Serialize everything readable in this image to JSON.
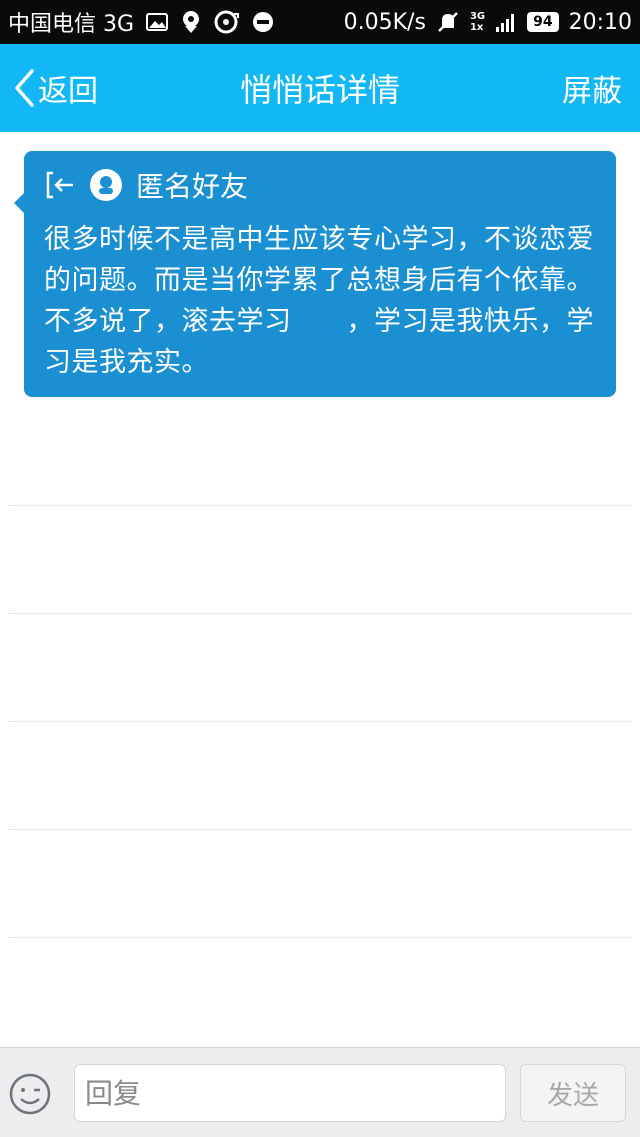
{
  "status_bar": {
    "carrier": "中国电信 3G",
    "speed": "0.05K/s",
    "net_top": "3G",
    "net_bottom": "1x",
    "battery": "94",
    "time": "20:10"
  },
  "header": {
    "back_label": "返回",
    "title": "悄悄话详情",
    "block_label": "屏蔽"
  },
  "message": {
    "sender": "匿名好友",
    "text": "很多时候不是高中生应该专心学习，不谈恋爱的问题。而是当你学累了总想身后有个依靠。不多说了，滚去学习　　，学习是我快乐，学习是我充实。"
  },
  "input_bar": {
    "placeholder": "回复",
    "send_label": "发送"
  },
  "colors": {
    "accent": "#12b7f5",
    "card": "#1a8fd2"
  }
}
